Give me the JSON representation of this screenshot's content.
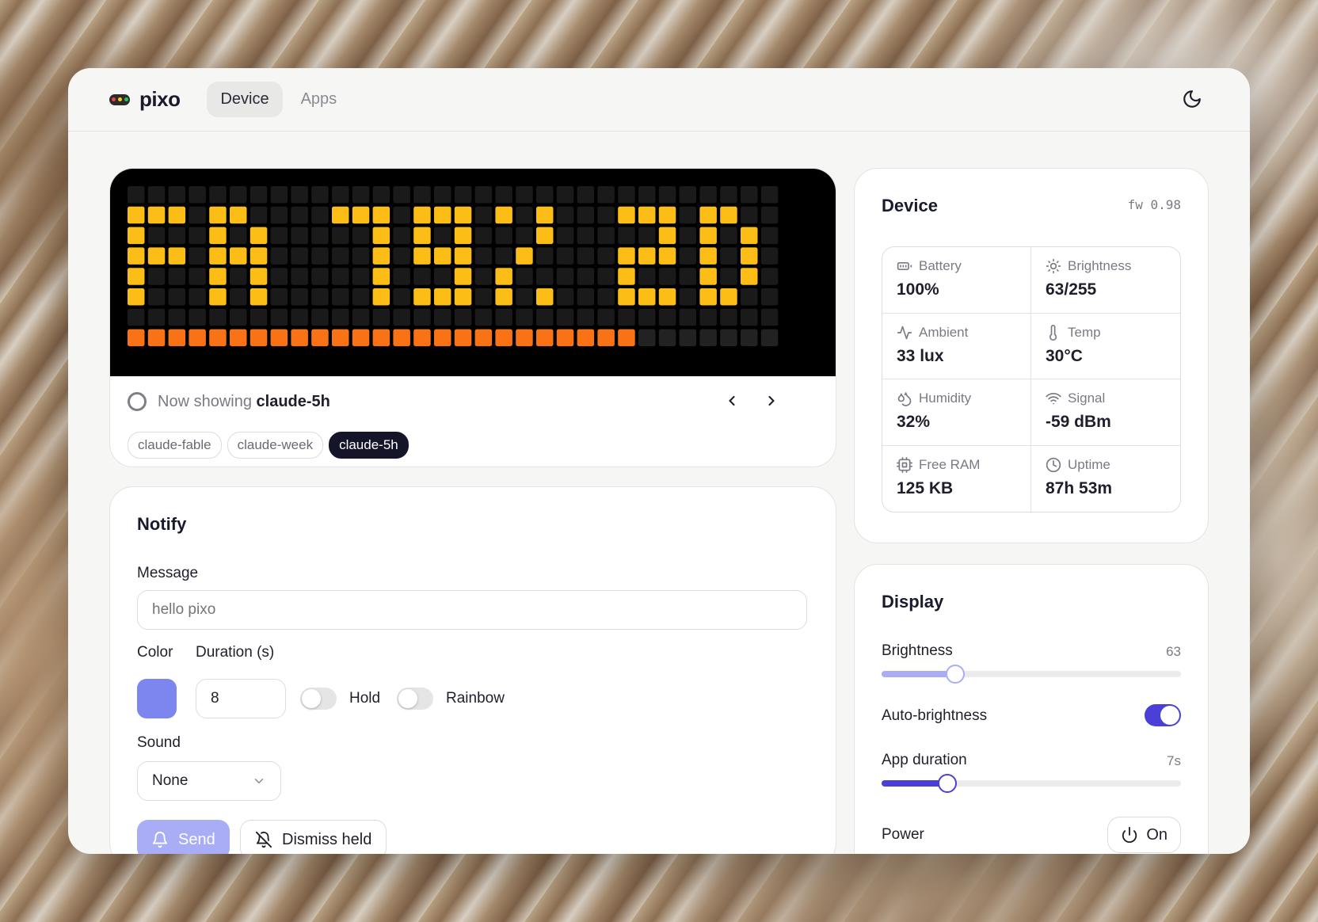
{
  "app": {
    "name": "pixo"
  },
  "tabs": [
    {
      "label": "Device",
      "active": true
    },
    {
      "label": "Apps",
      "active": false
    }
  ],
  "matrix": {
    "cols": 32,
    "rows": 8,
    "text_color": "#fbbd16",
    "bar_color": "#f97316",
    "bar_progress_cells": 25,
    "lit_pixels": [
      [
        1,
        0
      ],
      [
        1,
        1
      ],
      [
        1,
        2
      ],
      [
        1,
        4
      ],
      [
        1,
        5
      ],
      [
        1,
        10
      ],
      [
        1,
        11
      ],
      [
        1,
        12
      ],
      [
        1,
        14
      ],
      [
        1,
        15
      ],
      [
        1,
        16
      ],
      [
        1,
        18
      ],
      [
        1,
        20
      ],
      [
        1,
        24
      ],
      [
        1,
        25
      ],
      [
        1,
        26
      ],
      [
        1,
        28
      ],
      [
        1,
        29
      ],
      [
        2,
        0
      ],
      [
        2,
        4
      ],
      [
        2,
        6
      ],
      [
        2,
        12
      ],
      [
        2,
        14
      ],
      [
        2,
        16
      ],
      [
        2,
        20
      ],
      [
        2,
        26
      ],
      [
        2,
        28
      ],
      [
        2,
        30
      ],
      [
        3,
        0
      ],
      [
        3,
        1
      ],
      [
        3,
        2
      ],
      [
        3,
        4
      ],
      [
        3,
        5
      ],
      [
        3,
        6
      ],
      [
        3,
        12
      ],
      [
        3,
        14
      ],
      [
        3,
        15
      ],
      [
        3,
        16
      ],
      [
        3,
        19
      ],
      [
        3,
        24
      ],
      [
        3,
        25
      ],
      [
        3,
        26
      ],
      [
        3,
        28
      ],
      [
        3,
        30
      ],
      [
        4,
        0
      ],
      [
        4,
        4
      ],
      [
        4,
        6
      ],
      [
        4,
        12
      ],
      [
        4,
        16
      ],
      [
        4,
        18
      ],
      [
        4,
        24
      ],
      [
        4,
        28
      ],
      [
        4,
        30
      ],
      [
        5,
        0
      ],
      [
        5,
        4
      ],
      [
        5,
        6
      ],
      [
        5,
        12
      ],
      [
        5,
        14
      ],
      [
        5,
        15
      ],
      [
        5,
        16
      ],
      [
        5,
        18
      ],
      [
        5,
        20
      ],
      [
        5,
        24
      ],
      [
        5,
        25
      ],
      [
        5,
        26
      ],
      [
        5,
        28
      ],
      [
        5,
        29
      ]
    ]
  },
  "now_showing": {
    "prefix": "Now showing",
    "app": "claude-5h"
  },
  "chips": [
    {
      "label": "claude-fable",
      "active": false
    },
    {
      "label": "claude-week",
      "active": false
    },
    {
      "label": "claude-5h",
      "active": true
    }
  ],
  "notify": {
    "title": "Notify",
    "message_label": "Message",
    "message_placeholder": "hello pixo",
    "color_label": "Color",
    "color_value": "#7d86ef",
    "duration_label": "Duration (s)",
    "duration_value": "8",
    "hold_label": "Hold",
    "rainbow_label": "Rainbow",
    "sound_label": "Sound",
    "sound_value": "None",
    "send_label": "Send",
    "dismiss_label": "Dismiss held"
  },
  "device": {
    "title": "Device",
    "fw": "fw 0.98",
    "stats": [
      {
        "icon": "battery-icon",
        "label": "Battery",
        "value": "100%"
      },
      {
        "icon": "sun-icon",
        "label": "Brightness",
        "value": "63/255"
      },
      {
        "icon": "activity-icon",
        "label": "Ambient",
        "value": "33 lux"
      },
      {
        "icon": "thermometer-icon",
        "label": "Temp",
        "value": "30°C"
      },
      {
        "icon": "droplets-icon",
        "label": "Humidity",
        "value": "32%"
      },
      {
        "icon": "wifi-icon",
        "label": "Signal",
        "value": "-59 dBm"
      },
      {
        "icon": "cpu-icon",
        "label": "Free RAM",
        "value": "125 KB"
      },
      {
        "icon": "clock-icon",
        "label": "Uptime",
        "value": "87h 53m"
      }
    ]
  },
  "display": {
    "title": "Display",
    "brightness_label": "Brightness",
    "brightness_value": "63",
    "brightness_fraction": 0.247,
    "brightness_color": "#a8adf5",
    "auto_brightness_label": "Auto-brightness",
    "auto_brightness_on": true,
    "app_duration_label": "App duration",
    "app_duration_value": "7s",
    "app_duration_fraction": 0.22,
    "app_duration_color": "#4a40d8",
    "power_label": "Power",
    "power_value": "On"
  }
}
